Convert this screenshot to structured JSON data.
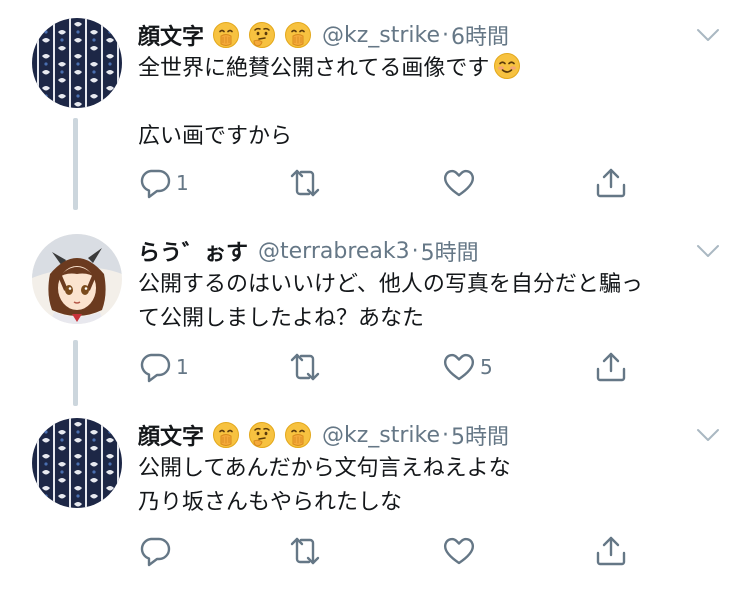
{
  "tweets": [
    {
      "display_name": "顔文字",
      "name_emojis": [
        "hand-over-mouth-emoji",
        "thinking-emoji",
        "hand-over-mouth-emoji"
      ],
      "handle": "@kz_strike",
      "separator": "·",
      "time": "6時間",
      "lines": [
        "全世界に絶賛公開されてる画像です",
        "",
        "広い画ですから"
      ],
      "trailing_emoji": "smiling-face-emoji",
      "reply_count": "1",
      "retweet_count": "",
      "like_count": ""
    },
    {
      "display_name": "らう゛ぉす",
      "name_emojis": [],
      "handle": "@terrabreak3",
      "separator": "·",
      "time": "5時間",
      "lines": [
        "公開するのはいいけど、他人の写真を自分だと騙っ",
        "て公開しましたよね？あなた"
      ],
      "trailing_emoji": "",
      "reply_count": "1",
      "retweet_count": "",
      "like_count": "5"
    },
    {
      "display_name": "顔文字",
      "name_emojis": [
        "hand-over-mouth-emoji",
        "thinking-emoji",
        "hand-over-mouth-emoji"
      ],
      "handle": "@kz_strike",
      "separator": "·",
      "time": "5時間",
      "lines": [
        "公開してあんだから文句言えねえよな",
        "乃り坂さんもやられたしな"
      ],
      "trailing_emoji": "",
      "reply_count": "",
      "retweet_count": "",
      "like_count": ""
    }
  ],
  "colors": {
    "text": "#14171a",
    "secondary": "#657786",
    "thread_line": "#ccd6dd",
    "emoji_yellow": "#f7c240",
    "avatar_navy": "#1d2746"
  }
}
